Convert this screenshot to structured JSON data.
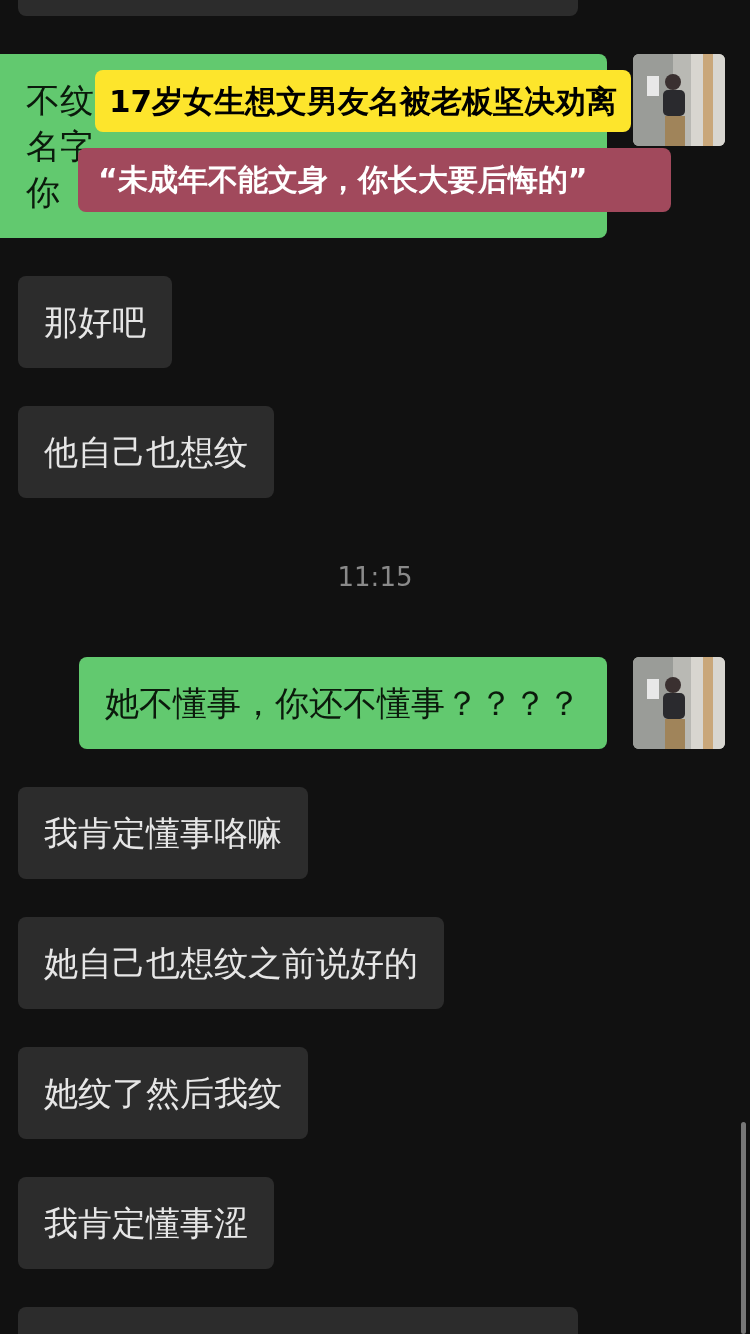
{
  "overlay": {
    "headline": "17岁女生想文男友名被老板坚决劝离",
    "quote": "“未成年不能文身，你长大要后悔的”"
  },
  "messages": [
    {
      "kind": "partial",
      "sent": false
    },
    {
      "kind": "text",
      "sent": true,
      "lines": [
        "不纹",
        "名字",
        "你"
      ]
    },
    {
      "kind": "text",
      "sent": false,
      "lines": [
        "那好吧"
      ]
    },
    {
      "kind": "text",
      "sent": false,
      "lines": [
        "他自己也想纹"
      ]
    },
    {
      "kind": "time",
      "text": "11:15"
    },
    {
      "kind": "text",
      "sent": true,
      "lines": [
        "她不懂事，你还不懂事？？？？"
      ]
    },
    {
      "kind": "text",
      "sent": false,
      "lines": [
        "我肯定懂事咯嘛"
      ]
    },
    {
      "kind": "text",
      "sent": false,
      "lines": [
        "她自己也想纹之前说好的"
      ]
    },
    {
      "kind": "text",
      "sent": false,
      "lines": [
        "她纹了然后我纹"
      ]
    },
    {
      "kind": "text",
      "sent": false,
      "lines": [
        "我肯定懂事涩"
      ]
    },
    {
      "kind": "partial",
      "sent": false
    }
  ]
}
